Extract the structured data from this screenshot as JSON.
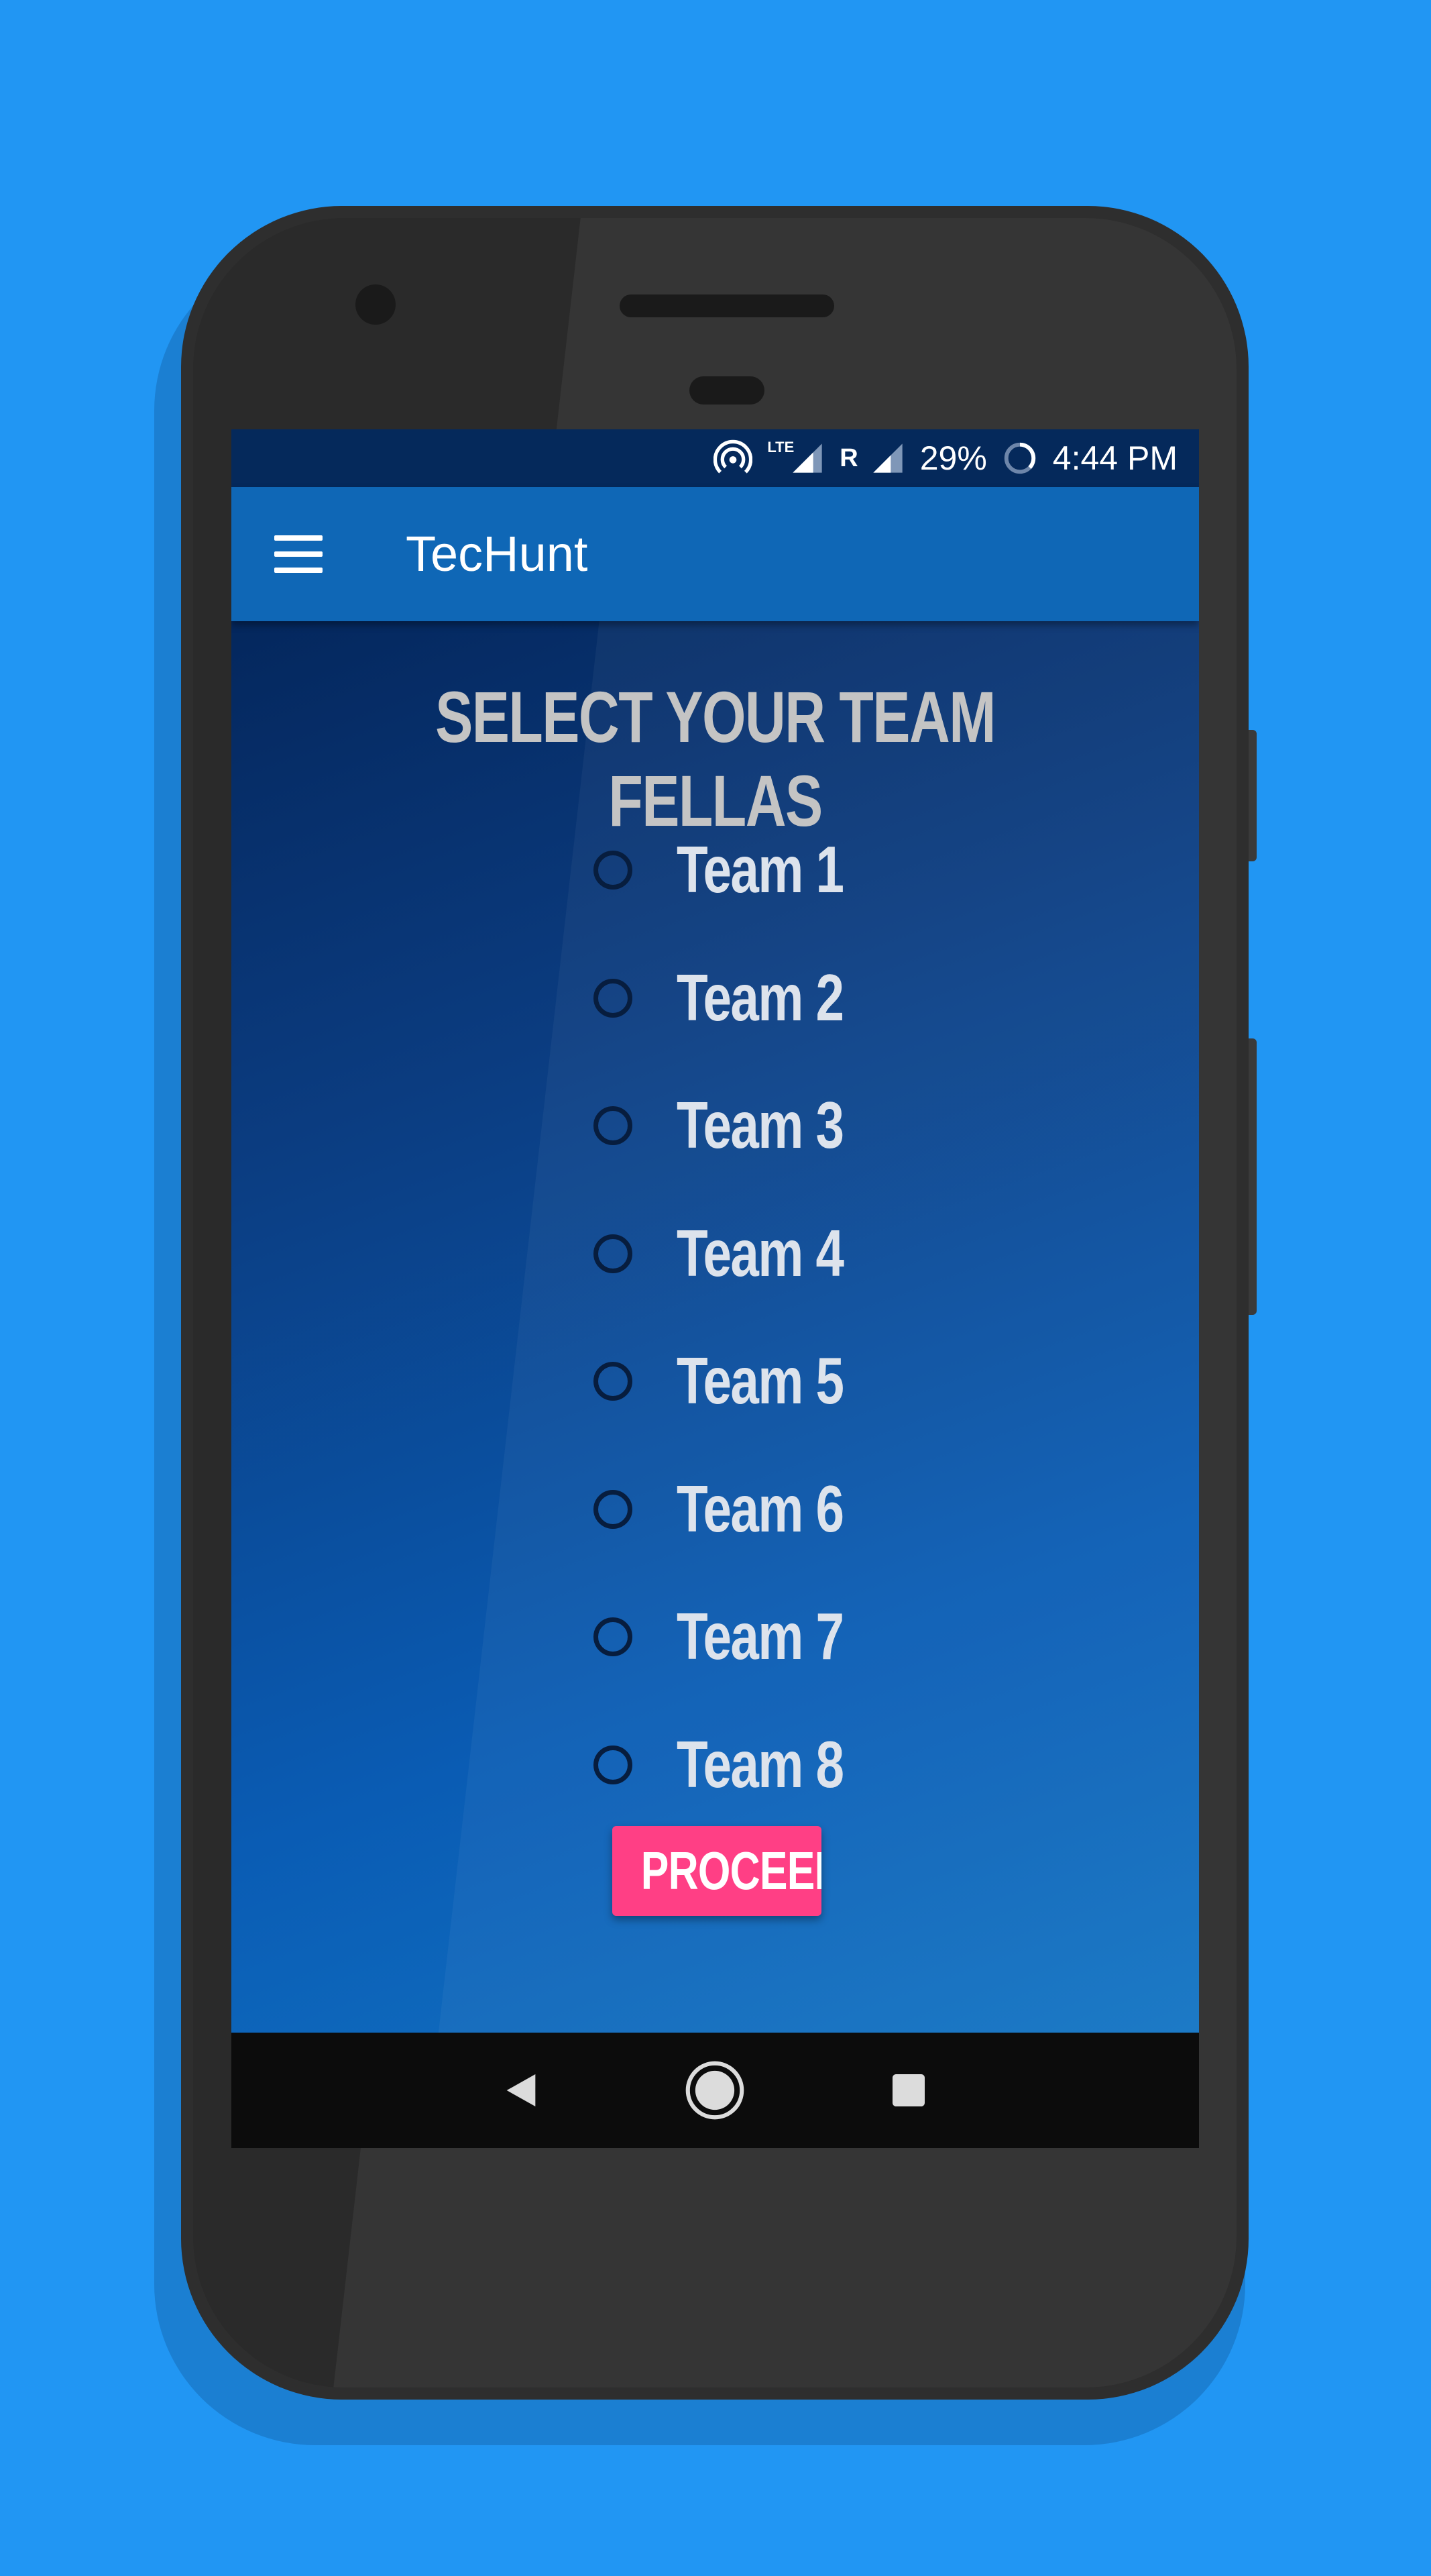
{
  "app": {
    "title": "TecHunt",
    "menu_icon": "hamburger-menu-icon"
  },
  "status_bar": {
    "icons": [
      "hotspot-icon",
      "lte-signal-icon",
      "roaming-signal-icon",
      "battery-saver-icon"
    ],
    "lte_label": "LTE",
    "roaming_label": "R",
    "battery": "29%",
    "time": "4:44 PM"
  },
  "main": {
    "heading": "SELECT YOUR TEAM FELLAS",
    "teams": [
      {
        "label": "Team 1",
        "selected": false
      },
      {
        "label": "Team 2",
        "selected": false
      },
      {
        "label": "Team 3",
        "selected": false
      },
      {
        "label": "Team 4",
        "selected": false
      },
      {
        "label": "Team 5",
        "selected": false
      },
      {
        "label": "Team 6",
        "selected": false
      },
      {
        "label": "Team 7",
        "selected": false
      },
      {
        "label": "Team 8",
        "selected": false
      }
    ],
    "proceed_label": "PROCEED"
  },
  "nav_bar": {
    "icons": [
      "back-icon",
      "home-icon",
      "recents-icon"
    ]
  },
  "colors": {
    "page_background": "#2196f3",
    "status_bar": "#05295b",
    "app_bar": "#0f67b6",
    "heading_text": "#c4c4c4",
    "proceed_button": "#ff3f85",
    "nav_bar": "#0c0c0c"
  }
}
